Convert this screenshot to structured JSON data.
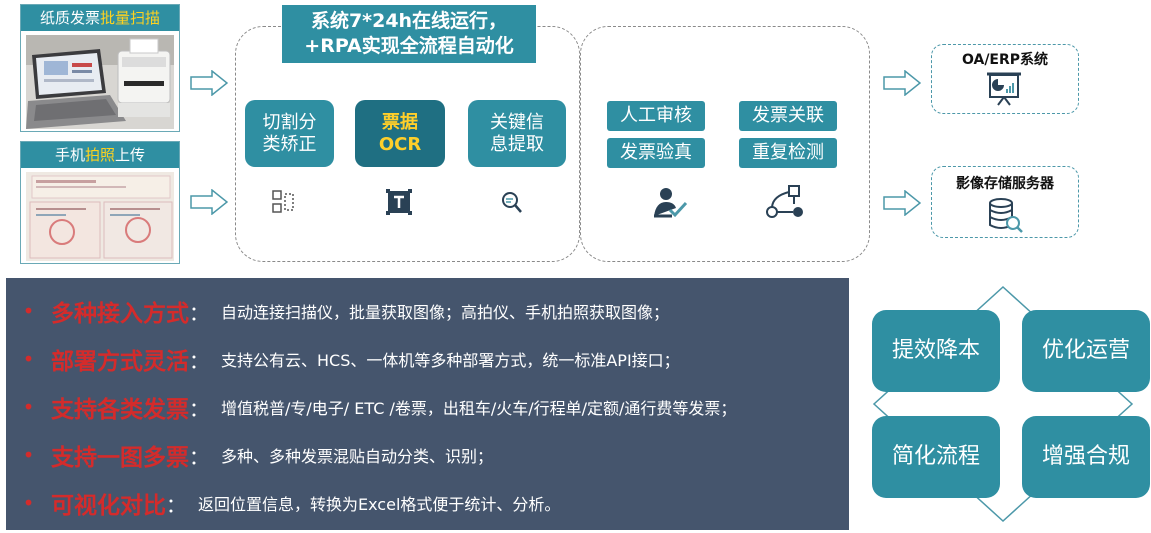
{
  "inputs": [
    {
      "title_plain": "纸质发票",
      "title_highlight": "批量扫描",
      "title_suffix": "",
      "image": "scanner-with-laptop"
    },
    {
      "title_plain": "手机",
      "title_highlight": "拍照",
      "title_suffix": "上传",
      "image": "invoice-photo"
    }
  ],
  "process": {
    "headline_line1": "系统7*24h在线运行，",
    "headline_line2": "+RPA实现全流程自动化",
    "steps": [
      {
        "line1": "切割分",
        "line2": "类矫正",
        "icon": "split-icon"
      },
      {
        "line1": "票据",
        "line2": "OCR",
        "icon": "text-recognition-icon"
      },
      {
        "line1": "关键信",
        "line2": "息提取",
        "icon": "search-extract-icon"
      }
    ]
  },
  "review": {
    "pills": [
      "人工审核",
      "发票关联",
      "发票验真",
      "重复检测"
    ],
    "icons": [
      "reviewer-check-icon",
      "workflow-icon"
    ]
  },
  "destinations": [
    {
      "label": "OA/ERP系统",
      "icon": "presentation-chart-icon"
    },
    {
      "label": "影像存储服务器",
      "icon": "database-search-icon"
    }
  ],
  "features": [
    {
      "title": "多种接入方式",
      "text": "自动连接扫描仪，批量获取图像；高拍仪、手机拍照获取图像；"
    },
    {
      "title": "部署方式灵活",
      "text": "支持公有云、HCS、一体机等多种部署方式，统一标准API接口；"
    },
    {
      "title": "支持各类发票",
      "text": "增值税普/专/电子/ ETC /卷票，出租车/火车/行程单/定额/通行费等发票；"
    },
    {
      "title": "支持一图多票",
      "text": "多种、多种发票混贴自动分类、识别；"
    },
    {
      "title": "可视化对比",
      "text": "返回位置信息，转换为Excel格式便于统计、分析。"
    }
  ],
  "feature_bullet": "•",
  "feature_colon": "：",
  "benefits": [
    "提效降本",
    "优化运营",
    "简化流程",
    "增强合规"
  ],
  "colors": {
    "teal": "#2f8fa2",
    "dark_teal": "#1f6f82",
    "highlight": "#ffd21f",
    "feature_title": "#d42b2b",
    "feature_bg": "#45556d"
  }
}
